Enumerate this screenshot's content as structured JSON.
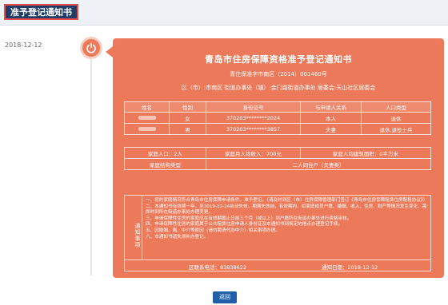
{
  "header": {
    "title": "准予登记通知书"
  },
  "timeline": {
    "date": "2018-12-12",
    "icon": "power-icon"
  },
  "card": {
    "title": "青岛市住房保障资格准予登记通知书",
    "doc_number": "青住保准字市南区（2014）001460号",
    "district_line": "区（市）:市南区   街道办事处（镇）:金门路街道办事处   居委会:天山社区居委会"
  },
  "members_table": {
    "headers": [
      "姓名",
      "性别",
      "身份证号",
      "与申请人关系",
      "人口类型"
    ],
    "rows": [
      [
        "",
        "女",
        "370203********2024",
        "本人",
        "退休"
      ],
      [
        "",
        "男",
        "370203********3857",
        "夫妻",
        "退休,退役士兵"
      ]
    ]
  },
  "summary": {
    "household_label": "家庭人口：2人",
    "income_label": "家庭月人均收入：700元",
    "area_label": "家庭人均建筑面积：0平方米",
    "structure_label": "家庭结构类型",
    "structure_value": "二人同住户（夫妻类）"
  },
  "notes": {
    "heading": "通知事项",
    "items": [
      "一、您的家庭情况符合青岛市住房保障申请条件，准予登记。（请及时到区（市）住房保障管理部门签订《青岛市住房保障租赁住房配租协议》）",
      "二、本通知书有效期一年，至2019-12-24自动失效，期满失效前，有效期内，如家庭成员户籍、婚姻、收入、住房、财产等情况发生变化，需即时到所在街道办事处办理变更。",
      "三、申请保障性住房的家庭应在有效期截止日前三个月（或以上）到户籍所在街道办事处进行资格审核。",
      "四、申请保障性住房的家庭属于公共租赁住房申请人身份证及本通知书到规定的地点办理登记手续。",
      "五、因婚姻、离、中介等原因（请勿聘请代办中介）相关事项办理。",
      "六、本通知书遗失须补办登记。"
    ],
    "phone_label": "区联系电话：83838622",
    "date_label": "通知日期：2018-12-12"
  },
  "footer": {
    "back_label": "返回"
  },
  "colors": {
    "card": "#ec7a5a",
    "header_bg": "#1f3d67",
    "back_button": "#1f5ea8"
  }
}
